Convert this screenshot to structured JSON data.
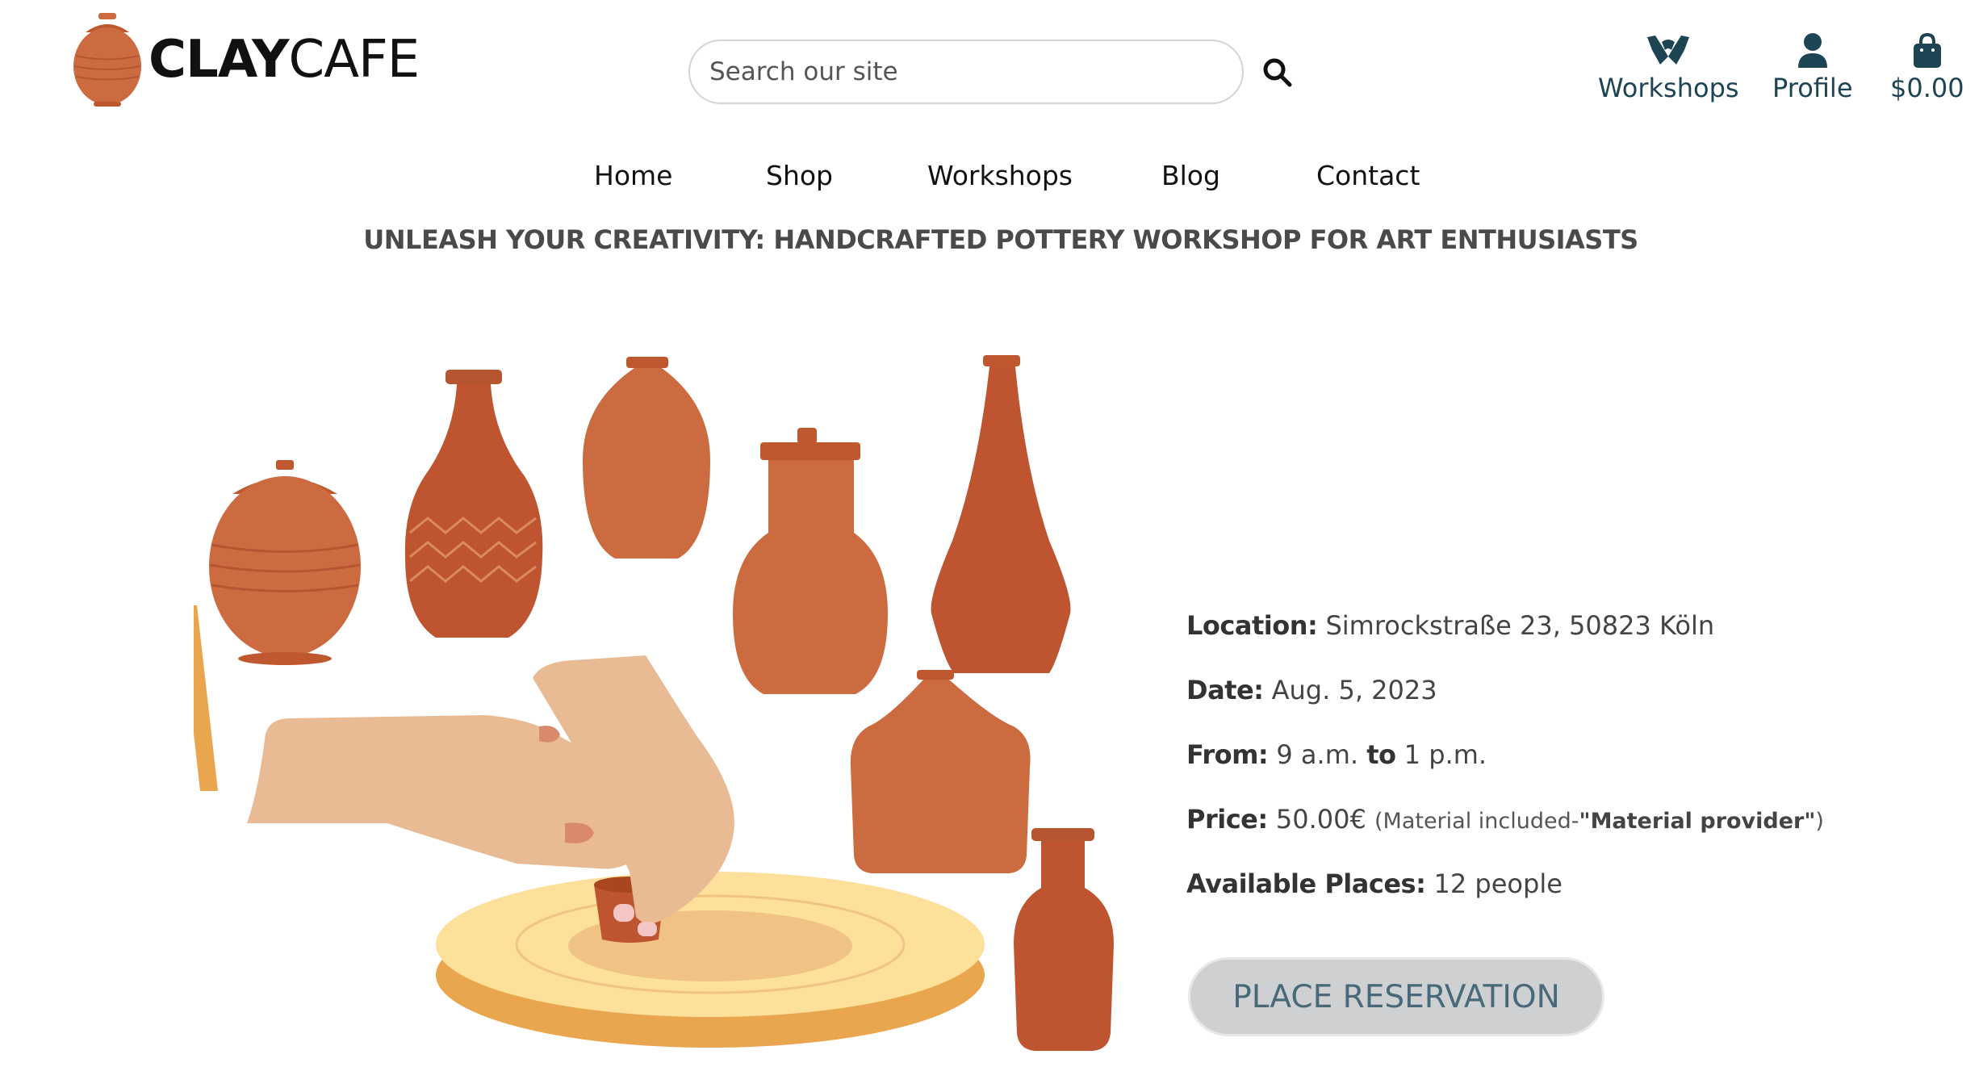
{
  "header": {
    "logo_text_bold": "CLAY",
    "logo_text_light": "CAFE",
    "search_placeholder": "Search our site",
    "nav_workshops": "Workshops",
    "nav_profile": "Profile",
    "cart_total": "$0.00"
  },
  "main_nav": [
    "Home",
    "Shop",
    "Workshops",
    "Blog",
    "Contact"
  ],
  "headline": "UNLEASH YOUR CREATIVITY: HANDCRAFTED POTTERY WORKSHOP FOR ART ENTHUSIASTS",
  "details": {
    "location_label": "Location:",
    "location_value": "Simrockstraße 23, 50823 Köln",
    "date_label": "Date:",
    "date_value": "Aug. 5, 2023",
    "from_label": "From:",
    "from_start": "9 a.m.",
    "to_label": "to",
    "from_end": "1 p.m.",
    "price_label": "Price:",
    "price_value": "50.00€",
    "price_note_prefix": "(Material included-",
    "price_note_bold": "\"Material provider\"",
    "price_note_suffix": ")",
    "places_label": "Available Places:",
    "places_value": "12 people"
  },
  "reserve_button": "PLACE RESERVATION",
  "colors": {
    "brand_dark": "#1d4452",
    "terracotta": "#cd6b40",
    "terracotta_dark": "#bf5530",
    "button_bg": "#cfd0d1",
    "button_text": "#47697a"
  },
  "icons": [
    "search-icon",
    "workshops-hands-icon",
    "profile-icon",
    "shopping-bag-icon"
  ]
}
